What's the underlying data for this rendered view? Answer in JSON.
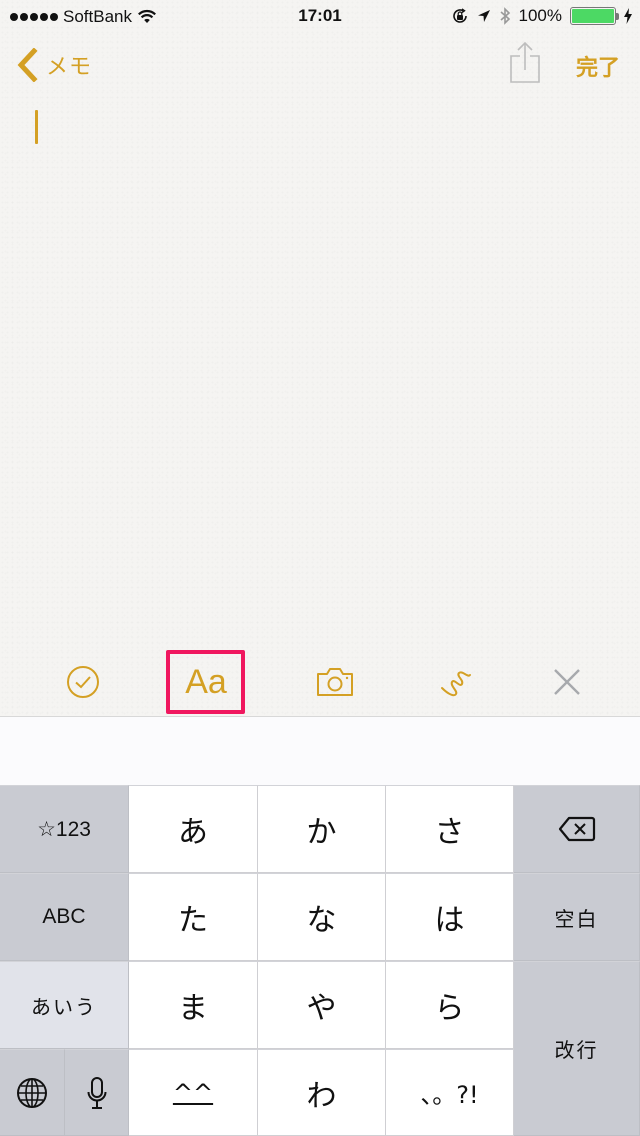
{
  "status_bar": {
    "signal_dots": 5,
    "carrier": "SoftBank",
    "time": "17:01",
    "battery_percent": "100%",
    "battery_level": 1.0,
    "icons": [
      "wifi-icon",
      "orientation-lock-icon",
      "location-icon",
      "bluetooth-icon",
      "battery-icon",
      "charging-icon"
    ]
  },
  "nav": {
    "back_label": "メモ",
    "done_label": "完了",
    "share_icon": "share-icon"
  },
  "editor": {
    "content": ""
  },
  "toolbar": {
    "items": [
      {
        "name": "checklist",
        "icon": "checkmark-circle-icon"
      },
      {
        "name": "format",
        "icon": "Aa",
        "label": "Aa",
        "highlighted": true
      },
      {
        "name": "camera",
        "icon": "camera-icon"
      },
      {
        "name": "sketch",
        "icon": "squiggle-icon"
      },
      {
        "name": "close",
        "icon": "close-icon"
      }
    ]
  },
  "keyboard": {
    "left": [
      "☆123",
      "ABC",
      "あいう"
    ],
    "bottom_left_icons": [
      "globe-icon",
      "microphone-icon"
    ],
    "rows": [
      [
        "あ",
        "か",
        "さ"
      ],
      [
        "た",
        "な",
        "は"
      ],
      [
        "ま",
        "や",
        "ら"
      ],
      [
        "^^",
        "わ",
        "、。?!"
      ]
    ],
    "right": {
      "delete_icon": "delete-icon",
      "space": "空白",
      "return": "改行"
    }
  },
  "colors": {
    "accent": "#d4a024",
    "highlight": "#f0175f",
    "battery": "#4cd964",
    "key_gray": "#c9cbd2"
  }
}
